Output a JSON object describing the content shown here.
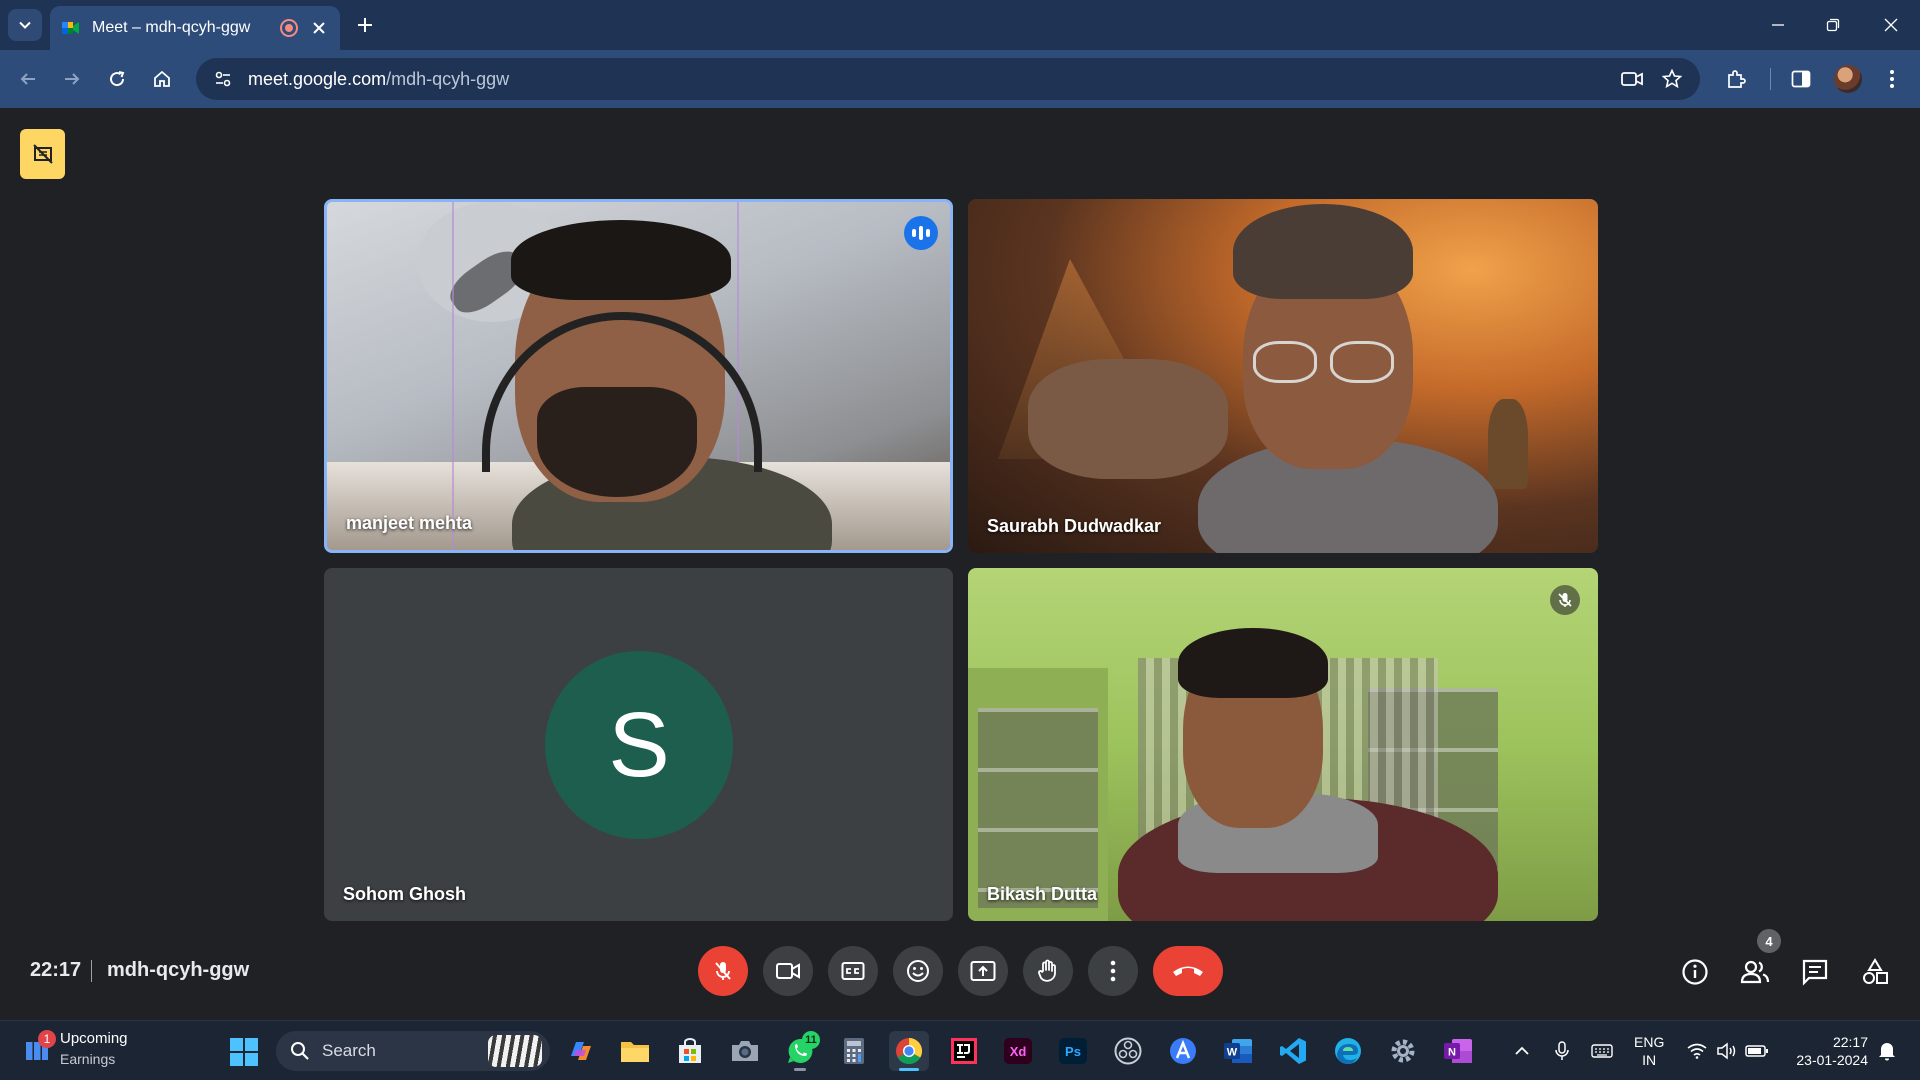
{
  "browser": {
    "tab": {
      "title": "Meet – mdh-qcyh-ggw"
    },
    "url": {
      "host": "meet.google.com",
      "path": "/mdh-qcyh-ggw"
    }
  },
  "meet": {
    "participants": [
      {
        "name": "manjeet mehta",
        "state": "speaking",
        "video": true
      },
      {
        "name": "Saurabh Dudwadkar",
        "state": "normal",
        "video": true
      },
      {
        "name": "Sohom Ghosh",
        "state": "normal",
        "video": false,
        "avatar_letter": "S",
        "avatar_color": "#1e5e4e"
      },
      {
        "name": "Bikash Dutta",
        "state": "muted",
        "video": true
      }
    ],
    "footer": {
      "time": "22:17",
      "meeting_code": "mdh-qcyh-ggw",
      "people_count": "4"
    },
    "controls": [
      "mic-off",
      "camera",
      "captions",
      "emoji",
      "present",
      "raise-hand",
      "more",
      "end-call"
    ],
    "side_controls": [
      "info",
      "people",
      "chat",
      "activities"
    ],
    "colors": {
      "end_call": "#ea4335",
      "speaking_border": "#8ab4f8",
      "accent_badge": "#fdd663"
    }
  },
  "taskbar": {
    "widget": {
      "badge": "1",
      "line1": "Upcoming",
      "line2": "Earnings"
    },
    "search": {
      "placeholder": "Search"
    },
    "whatsapp_badge": "11",
    "apps": [
      "copilot",
      "file-explorer",
      "microsoft-store",
      "camera",
      "whatsapp",
      "calculator",
      "chrome",
      "intellij",
      "adobe-xd",
      "photoshop",
      "obs",
      "app-a",
      "word",
      "vscode",
      "edge",
      "settings",
      "onenote"
    ],
    "tray": {
      "lang_line1": "ENG",
      "lang_line2": "IN",
      "time": "22:17",
      "date": "23-01-2024"
    }
  }
}
